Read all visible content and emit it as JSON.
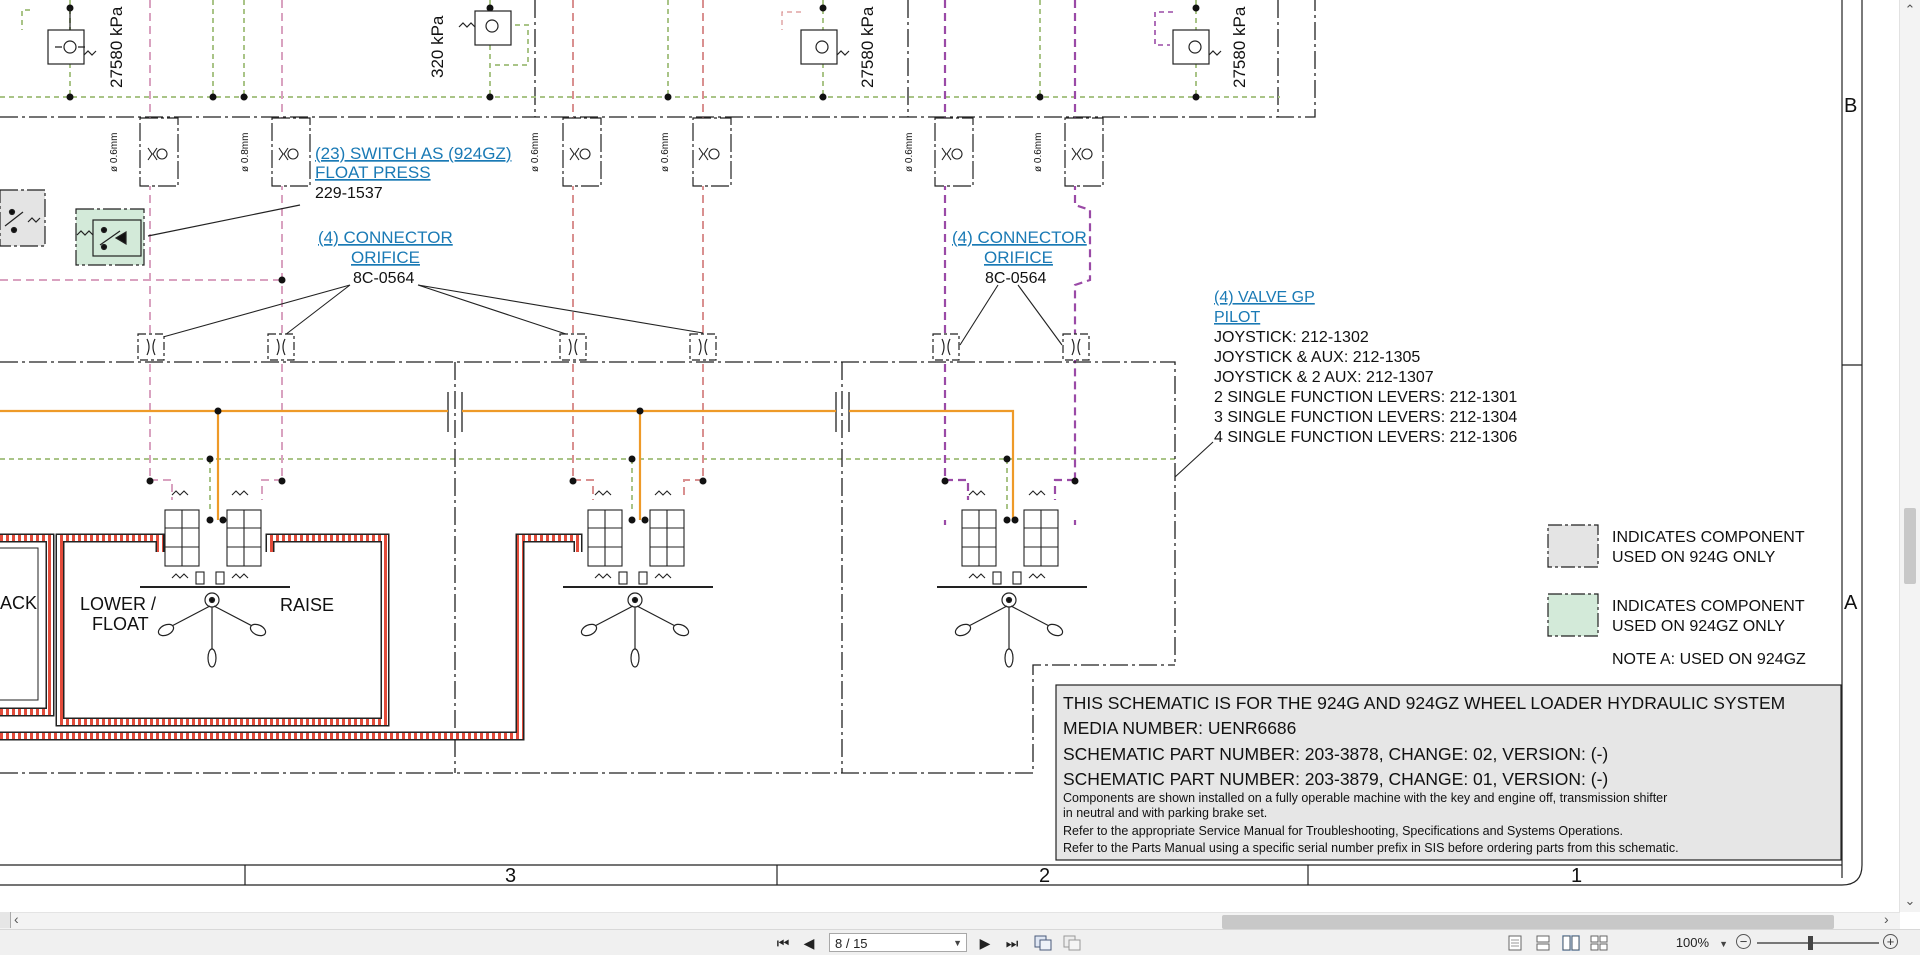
{
  "schematic": {
    "pressures": [
      "27580 kPa",
      "320 kPa",
      "27580 kPa",
      "27580 kPa"
    ],
    "orifice_size": "ø 0.6mm",
    "orifice_size_alt": "ø 0.8mm",
    "switch_label_1": "(23) SWITCH AS (924GZ)",
    "switch_label_2": "FLOAT PRESS",
    "switch_part": "229-1537",
    "connector_left_1": "(4) CONNECTOR",
    "connector_left_2": "ORIFICE",
    "connector_left_part": "8C-0564",
    "connector_right_1": "(4) CONNECTOR",
    "connector_right_2": "ORIFICE",
    "connector_right_part": "8C-0564",
    "valve_title_1": "(4) VALVE GP",
    "valve_title_2": "PILOT",
    "valve_parts": [
      "JOYSTICK: 212-1302",
      "JOYSTICK & AUX: 212-1305",
      "JOYSTICK & 2 AUX: 212-1307",
      "2 SINGLE FUNCTION LEVERS: 212-1301",
      "3 SINGLE FUNCTION LEVERS: 212-1304",
      "4 SINGLE FUNCTION LEVERS: 212-1306"
    ],
    "joystick_labels": {
      "back": "ACK",
      "lower_1": "LOWER /",
      "lower_2": "FLOAT",
      "raise": "RAISE"
    },
    "legend": [
      {
        "line1": "INDICATES COMPONENT",
        "line2": "USED ON 924G ONLY",
        "color": "#e4e4e4"
      },
      {
        "line1": "INDICATES COMPONENT",
        "line2": "USED ON 924GZ ONLY",
        "color": "#d3ead9"
      }
    ],
    "note_a": "NOTE A: USED ON 924GZ",
    "grid_rows": [
      "B",
      "A"
    ],
    "grid_cols": [
      "3",
      "2",
      "1"
    ],
    "title_block": {
      "line1": "THIS SCHEMATIC IS FOR THE 924G AND 924GZ WHEEL LOADER HYDRAULIC SYSTEM",
      "line2": "MEDIA NUMBER: UENR6686",
      "line3": "SCHEMATIC PART NUMBER: 203-3878, CHANGE: 02, VERSION: (-)",
      "line4": "SCHEMATIC PART NUMBER: 203-3879, CHANGE: 01, VERSION: (-)",
      "note1": "Components are shown installed on a fully operable machine with the key and engine off, transmission shifter",
      "note2": "in neutral and with parking brake set.",
      "note3": "Refer to the appropriate Service Manual for Troubleshooting, Specifications and Systems Operations.",
      "note4": "Refer to the Parts Manual using a specific serial number prefix in SIS before ordering parts from this schematic."
    }
  },
  "toolbar": {
    "page_field": "8 / 15",
    "zoom": "100%"
  },
  "colors": {
    "pilot_green": "#a9c487",
    "pilot_pink": "#d9a2c0",
    "pilot_red": "#d99090",
    "pilot_purple": "#9a4aa6",
    "supply_orange": "#ee9a28",
    "return_red": "#e24b3a",
    "link_blue": "#1a7ab5"
  }
}
